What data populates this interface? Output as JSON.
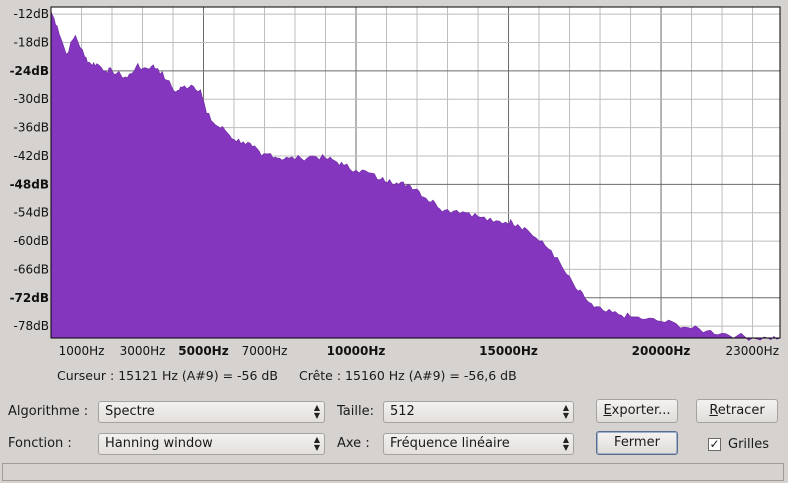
{
  "chart_data": {
    "type": "area",
    "ylabels": [
      "-12dB",
      "-18dB",
      "-24dB",
      "-30dB",
      "-36dB",
      "-42dB",
      "-48dB",
      "-54dB",
      "-60dB",
      "-66dB",
      "-72dB",
      "-78dB"
    ],
    "yticks": [
      -12,
      -18,
      -24,
      -30,
      -36,
      -42,
      -48,
      -54,
      -60,
      -66,
      -72,
      -78
    ],
    "ylim": [
      -80.5,
      -10.5
    ],
    "xlim": [
      0,
      23900
    ],
    "xtick_labels": [
      {
        "f": 1000,
        "label": "1000Hz",
        "bold": false
      },
      {
        "f": 3000,
        "label": "3000Hz",
        "bold": false
      },
      {
        "f": 5000,
        "label": "5000Hz",
        "bold": true
      },
      {
        "f": 7000,
        "label": "7000Hz",
        "bold": false
      },
      {
        "f": 10000,
        "label": "10000Hz",
        "bold": true
      },
      {
        "f": 15000,
        "label": "15000Hz",
        "bold": true
      },
      {
        "f": 20000,
        "label": "20000Hz",
        "bold": true
      },
      {
        "f": 23000,
        "label": "23000Hz",
        "bold": false
      }
    ],
    "fill_color": "#8436bf",
    "grid": true,
    "x": [
      0,
      200,
      500,
      800,
      1100,
      1300,
      1500,
      1800,
      2000,
      2300,
      2500,
      2800,
      3000,
      3300,
      3500,
      3800,
      4100,
      4300,
      4600,
      4900,
      5100,
      5400,
      5700,
      6000,
      6300,
      6600,
      6900,
      7200,
      7500,
      7800,
      8200,
      8600,
      9000,
      9300,
      9600,
      10000,
      10400,
      10800,
      11100,
      11400,
      11700,
      12000,
      12300,
      12600,
      12900,
      13300,
      13700,
      14100,
      14500,
      14900,
      15121,
      15300,
      15600,
      16000,
      16400,
      16800,
      17200,
      17500,
      17800,
      18200,
      18600,
      19000,
      19500,
      20000,
      20500,
      21000,
      21500,
      22000,
      22500,
      23000,
      23500,
      23900
    ],
    "y": [
      -11.5,
      -14.5,
      -20.5,
      -16.5,
      -21,
      -22.5,
      -22.5,
      -24,
      -24,
      -25,
      -25.5,
      -23,
      -23.5,
      -23,
      -23.5,
      -26,
      -28.5,
      -27.5,
      -27,
      -28,
      -33,
      -35.5,
      -36.5,
      -38.5,
      -39,
      -40,
      -42,
      -41.5,
      -42.5,
      -42.5,
      -42.5,
      -42,
      -42.5,
      -43,
      -44,
      -45,
      -45.5,
      -47,
      -47,
      -48,
      -48,
      -49,
      -51,
      -52,
      -53.5,
      -53.5,
      -54,
      -55,
      -56,
      -56,
      -56,
      -56.5,
      -57.5,
      -60,
      -62,
      -66,
      -70,
      -72,
      -74,
      -75,
      -75.5,
      -76,
      -76.5,
      -77,
      -77.5,
      -78.5,
      -79,
      -79.5,
      -80,
      -80.5,
      -80.5,
      -80.5
    ]
  },
  "status": {
    "cursor": "Curseur : 15121 Hz (A#9) = -56 dB",
    "peak": "Crête : 15160 Hz (A#9) = -56,6 dB"
  },
  "controls": {
    "algo_label": "Algorithme :",
    "algo_value": "Spectre",
    "size_label": "Taille:",
    "size_value": "512",
    "func_label": "Fonction :",
    "func_value": "Hanning window",
    "axis_label": "Axe :",
    "axis_value": "Fréquence linéaire",
    "export_first": "E",
    "export_rest": "xporter...",
    "redraw_first": "R",
    "redraw_rest": "etracer",
    "close_label": "Fermer",
    "grid_label": "Grilles",
    "grid_checked": "✓"
  },
  "icons": {
    "combo_arrow_up": "▲",
    "combo_arrow_down": "▼"
  }
}
